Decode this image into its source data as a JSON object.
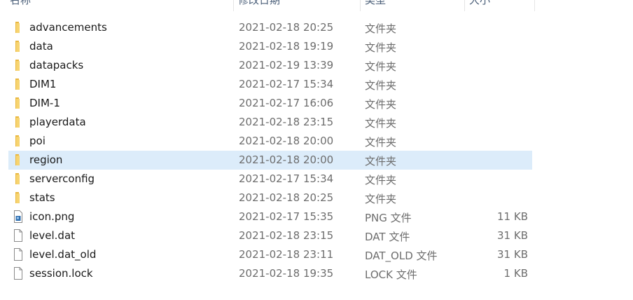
{
  "columns": {
    "name": "名称",
    "date": "修改日期",
    "type": "类型",
    "size": "大小"
  },
  "files": [
    {
      "name": "advancements",
      "date": "2021-02-18 20:25",
      "type": "文件夹",
      "size": "",
      "icon": "folder-icon"
    },
    {
      "name": "data",
      "date": "2021-02-18 19:19",
      "type": "文件夹",
      "size": "",
      "icon": "folder-icon"
    },
    {
      "name": "datapacks",
      "date": "2021-02-19 13:39",
      "type": "文件夹",
      "size": "",
      "icon": "folder-icon"
    },
    {
      "name": "DIM1",
      "date": "2021-02-17 15:34",
      "type": "文件夹",
      "size": "",
      "icon": "folder-icon"
    },
    {
      "name": "DIM-1",
      "date": "2021-02-17 16:06",
      "type": "文件夹",
      "size": "",
      "icon": "folder-icon"
    },
    {
      "name": "playerdata",
      "date": "2021-02-18 23:15",
      "type": "文件夹",
      "size": "",
      "icon": "folder-icon"
    },
    {
      "name": "poi",
      "date": "2021-02-18 20:00",
      "type": "文件夹",
      "size": "",
      "icon": "folder-icon"
    },
    {
      "name": "region",
      "date": "2021-02-18 20:00",
      "type": "文件夹",
      "size": "",
      "icon": "folder-icon",
      "selected": true
    },
    {
      "name": "serverconfig",
      "date": "2021-02-17 15:34",
      "type": "文件夹",
      "size": "",
      "icon": "folder-icon"
    },
    {
      "name": "stats",
      "date": "2021-02-18 20:25",
      "type": "文件夹",
      "size": "",
      "icon": "folder-icon"
    },
    {
      "name": "icon.png",
      "date": "2021-02-17 15:35",
      "type": "PNG 文件",
      "size": "11 KB",
      "icon": "image-file-icon"
    },
    {
      "name": "level.dat",
      "date": "2021-02-18 23:15",
      "type": "DAT 文件",
      "size": "31 KB",
      "icon": "file-icon"
    },
    {
      "name": "level.dat_old",
      "date": "2021-02-18 23:11",
      "type": "DAT_OLD 文件",
      "size": "31 KB",
      "icon": "file-icon"
    },
    {
      "name": "session.lock",
      "date": "2021-02-18 19:35",
      "type": "LOCK 文件",
      "size": "1 KB",
      "icon": "file-icon"
    }
  ],
  "colors": {
    "selected_row": "#dcecfa",
    "folder": "#f2c14e"
  }
}
